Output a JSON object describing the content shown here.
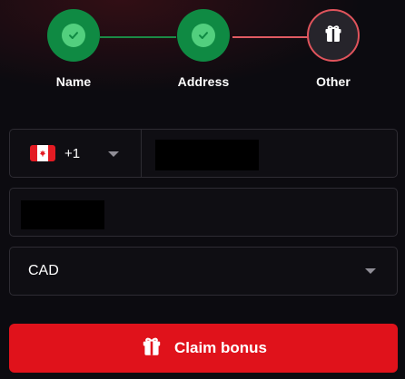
{
  "stepper": {
    "steps": [
      {
        "label": "Name",
        "state": "completed"
      },
      {
        "label": "Address",
        "state": "completed"
      },
      {
        "label": "Other",
        "state": "current"
      }
    ],
    "icons": {
      "completed": "check-icon",
      "current": "gift-icon"
    }
  },
  "phone": {
    "country_flag": "canada-flag-icon",
    "dial_code": "+1"
  },
  "currency": {
    "selected": "CAD"
  },
  "claim_button": {
    "label": "Claim bonus",
    "icon": "gift-icon"
  },
  "colors": {
    "background": "#0c0b10",
    "completed_step": "#0f8a43",
    "completed_check": "#52cf7e",
    "current_border": "#e0545c",
    "primary_button": "#e0121b"
  }
}
